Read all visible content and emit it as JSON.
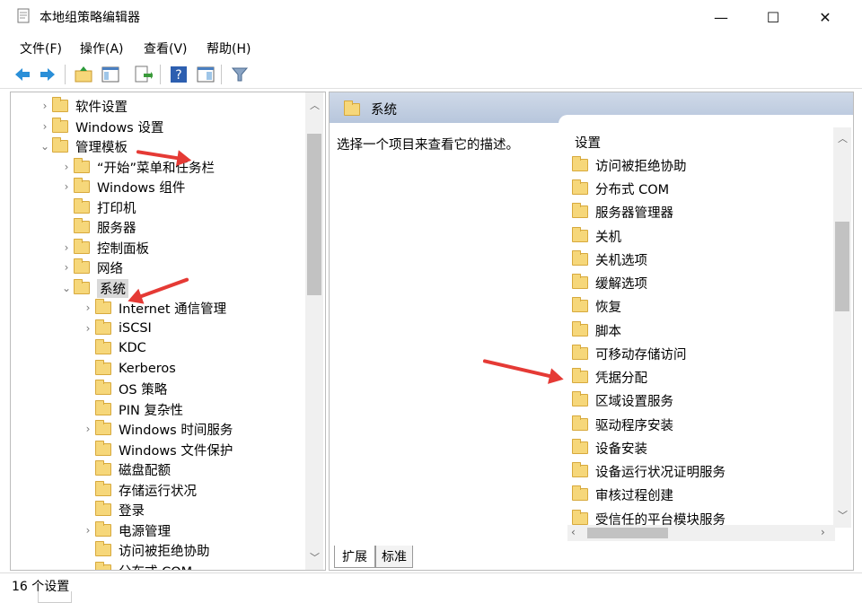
{
  "window": {
    "title": "本地组策略编辑器",
    "minimize": "—",
    "maximize": "☐",
    "close": "✕"
  },
  "menu": [
    {
      "label": "文件(F)"
    },
    {
      "label": "操作(A)"
    },
    {
      "label": "查看(V)"
    },
    {
      "label": "帮助(H)"
    }
  ],
  "toolbar": {
    "icons": [
      "back-icon",
      "forward-icon",
      "up-folder-icon",
      "show-hide-tree-icon",
      "export-list-icon",
      "help-icon",
      "properties-icon",
      "filter-icon"
    ]
  },
  "tree": {
    "items": [
      {
        "label": "软件设置",
        "chevron": "›"
      },
      {
        "label": "Windows 设置",
        "chevron": "›"
      },
      {
        "label": "管理模板",
        "chevron": "⌄"
      },
      {
        "label": "“开始”菜单和任务栏",
        "chevron": "›"
      },
      {
        "label": "Windows 组件",
        "chevron": "›"
      },
      {
        "label": "打印机",
        "chevron": ""
      },
      {
        "label": "服务器",
        "chevron": ""
      },
      {
        "label": "控制面板",
        "chevron": "›"
      },
      {
        "label": "网络",
        "chevron": "›"
      },
      {
        "label": "系统",
        "chevron": "⌄"
      },
      {
        "label": "Internet 通信管理",
        "chevron": "›"
      },
      {
        "label": "iSCSI",
        "chevron": "›"
      },
      {
        "label": "KDC",
        "chevron": ""
      },
      {
        "label": "Kerberos",
        "chevron": ""
      },
      {
        "label": "OS 策略",
        "chevron": ""
      },
      {
        "label": "PIN 复杂性",
        "chevron": ""
      },
      {
        "label": "Windows 时间服务",
        "chevron": "›"
      },
      {
        "label": "Windows 文件保护",
        "chevron": ""
      },
      {
        "label": "磁盘配额",
        "chevron": ""
      },
      {
        "label": "存储运行状况",
        "chevron": ""
      },
      {
        "label": "登录",
        "chevron": ""
      },
      {
        "label": "电源管理",
        "chevron": "›"
      },
      {
        "label": "访问被拒绝协助",
        "chevron": ""
      },
      {
        "label": "分布式 COM",
        "chevron": ""
      }
    ]
  },
  "right": {
    "header": "系统",
    "description": "选择一个项目来查看它的描述。",
    "settings_heading": "设置",
    "settings": [
      "访问被拒绝协助",
      "分布式 COM",
      "服务器管理器",
      "关机",
      "关机选项",
      "缓解选项",
      "恢复",
      "脚本",
      "可移动存储访问",
      "凭据分配",
      "区域设置服务",
      "驱动程序安装",
      "设备安装",
      "设备运行状况证明服务",
      "审核过程创建",
      "受信任的平台模块服务"
    ]
  },
  "tabs": [
    {
      "label": "扩展"
    },
    {
      "label": "标准"
    }
  ],
  "status": {
    "text": "16 个设置"
  },
  "colors": {
    "annotation_arrow": "#e53a35",
    "header_bg": "#c4d1e3",
    "selection": "#d9d9d9"
  }
}
